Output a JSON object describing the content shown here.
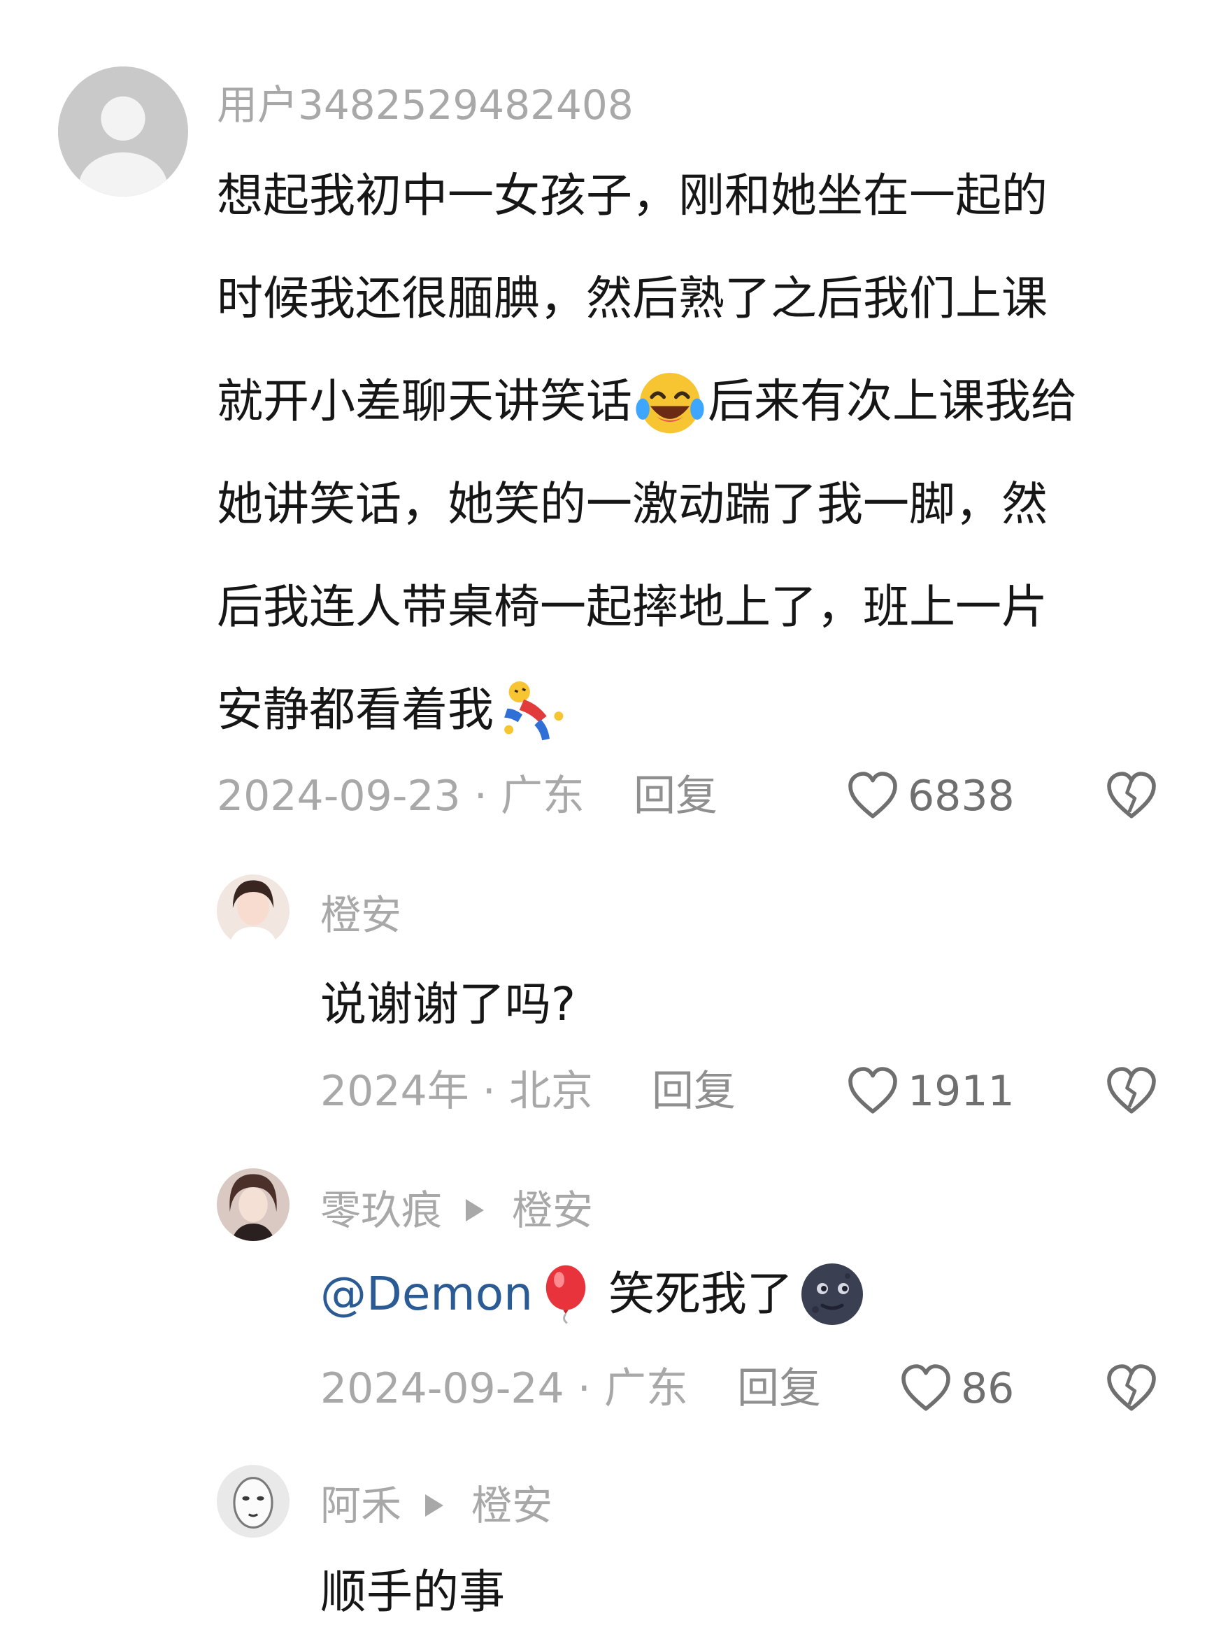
{
  "comment": {
    "username": "用户3482529482408",
    "lines": [
      "想起我初中一女孩子，刚和她坐在一起的",
      "时候我还很腼腆，然后熟了之后我们上课",
      "就开小差聊天讲笑话",
      "后来有次上课我给",
      "她讲笑话，她笑的一激动踹了我一脚，然",
      "后我连人带桌椅一起摔地上了，班上一片",
      "安静都看着我"
    ],
    "date_location": "2024-09-23 · 广东",
    "reply_label": "回复",
    "likes": "6838"
  },
  "replies": [
    {
      "username": "橙安",
      "text": "说谢谢了吗?",
      "date_location": "2024年 · 北京",
      "reply_label": "回复",
      "likes": "1911"
    },
    {
      "username": "零玖痕",
      "reply_to": "橙安",
      "mention": "@Demon",
      "text": "笑死我了",
      "date_location": "2024-09-24 · 广东",
      "reply_label": "回复",
      "likes": "86"
    },
    {
      "username": "阿禾",
      "reply_to": "橙安",
      "text": "顺手的事"
    }
  ],
  "icons": {
    "like": "heart-outline-icon",
    "dislike": "broken-heart-icon",
    "reply_arrow": "triangle-right-icon",
    "emoji_1": "tears-of-joy-emoji",
    "emoji_2": "falling-person-sticker",
    "emoji_3": "red-balloon-emoji",
    "emoji_4": "new-moon-face-emoji"
  },
  "colors": {
    "text": "#161616",
    "muted": "#a8a8a8",
    "mention": "#2a5b94"
  }
}
